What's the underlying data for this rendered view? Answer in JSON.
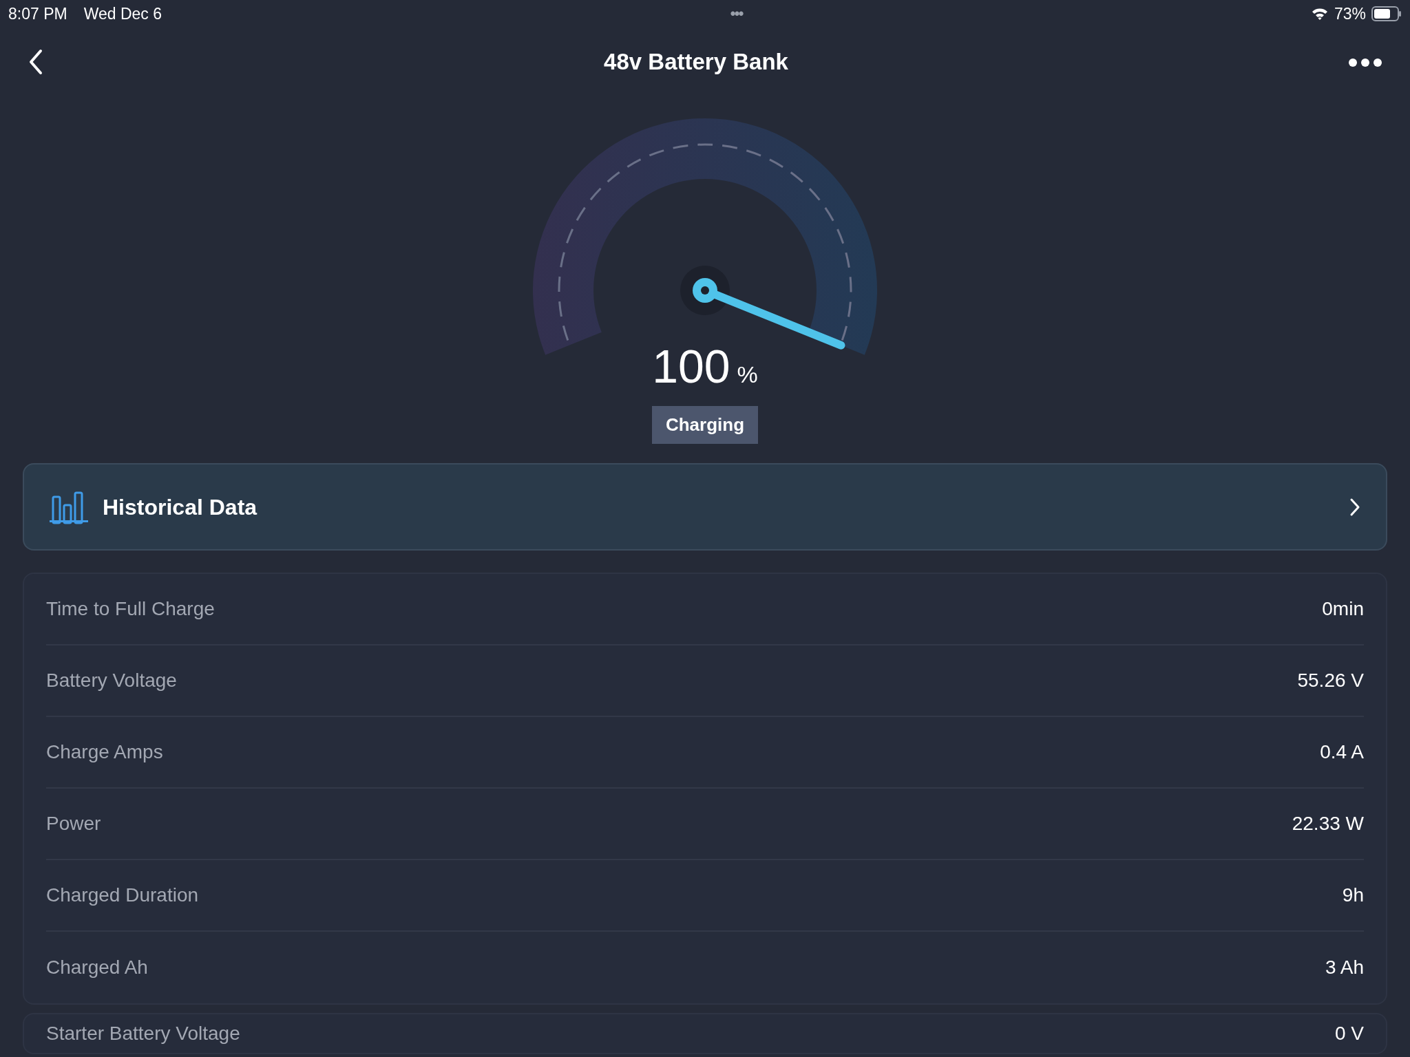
{
  "status_bar": {
    "time": "8:07 PM",
    "date": "Wed Dec 6",
    "multitask": "•••",
    "battery_text": "73%"
  },
  "header": {
    "title": "48v Battery Bank"
  },
  "gauge": {
    "value": "100",
    "unit": "%",
    "status": "Charging"
  },
  "history_link": {
    "label": "Historical Data"
  },
  "stats": [
    {
      "label": "Time to Full Charge",
      "value": "0min"
    },
    {
      "label": "Battery Voltage",
      "value": "55.26 V"
    },
    {
      "label": "Charge Amps",
      "value": "0.4 A"
    },
    {
      "label": "Power",
      "value": "22.33 W"
    },
    {
      "label": "Charged Duration",
      "value": "9h"
    },
    {
      "label": "Charged Ah",
      "value": "3 Ah"
    }
  ],
  "stats_2": [
    {
      "label": "Starter Battery Voltage",
      "value": "0 V"
    }
  ]
}
